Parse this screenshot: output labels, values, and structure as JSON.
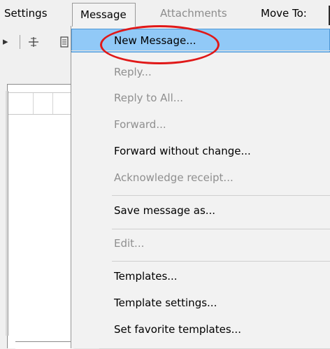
{
  "menubar": {
    "settings": "Settings",
    "message": "Message",
    "attachments": "Attachments",
    "move_to": "Move To:"
  },
  "toolbar": {
    "icons": [
      "play-arrow-icon",
      "crosshair-icon",
      "document-icon"
    ]
  },
  "dropdown": {
    "items": [
      {
        "label": "New Message...",
        "enabled": true,
        "highlighted": true
      },
      {
        "label": "Reply...",
        "enabled": false
      },
      {
        "label": "Reply to All...",
        "enabled": false
      },
      {
        "label": "Forward...",
        "enabled": false
      },
      {
        "label": "Forward without change...",
        "enabled": true
      },
      {
        "label": "Acknowledge receipt...",
        "enabled": false
      },
      {
        "label": "Save message as...",
        "enabled": true
      },
      {
        "label": "Edit...",
        "enabled": false
      },
      {
        "label": "Templates...",
        "enabled": true
      },
      {
        "label": "Template settings...",
        "enabled": true
      },
      {
        "label": "Set favorite templates...",
        "enabled": true
      }
    ]
  },
  "colors": {
    "highlight": "#91c9f7",
    "highlight_border": "#4c97d6",
    "annotation": "#e01818",
    "disabled_text": "#8f8f8f"
  }
}
